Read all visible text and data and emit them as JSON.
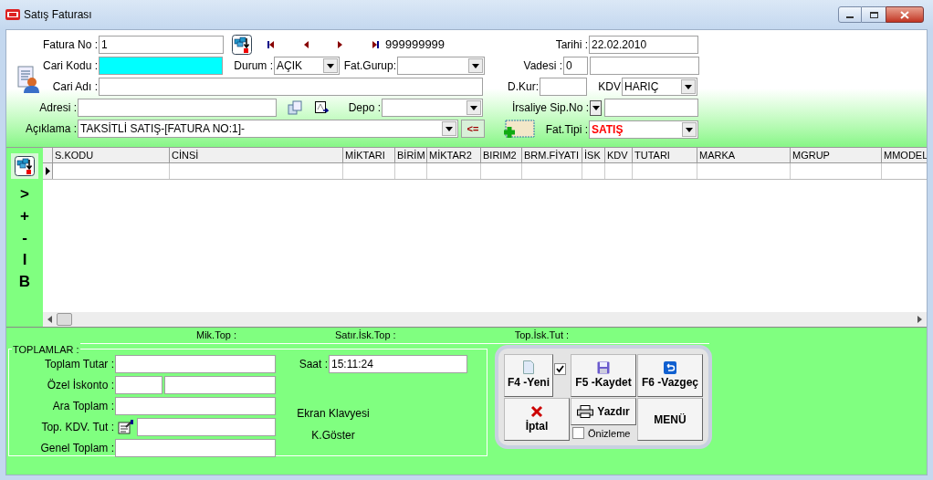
{
  "window": {
    "title": "Satış Faturası"
  },
  "header": {
    "fatura_no": {
      "label": "Fatura No :",
      "value": "1"
    },
    "record_number": "999999999",
    "cari_kodu": {
      "label": "Cari Kodu :"
    },
    "durum": {
      "label": "Durum :",
      "value": "AÇIK"
    },
    "fat_gurup": {
      "label": "Fat.Gurup:"
    },
    "cari_adi": {
      "label": "Cari Adı :"
    },
    "adresi": {
      "label": "Adresi :"
    },
    "depo": {
      "label": "Depo :"
    },
    "aciklama": {
      "label": "Açıklama :",
      "value": "TAKSİTLİ SATIŞ-[FATURA NO:1]-"
    },
    "aciklama_button": "<=",
    "tarihi": {
      "label": "Tarihi :",
      "value": "22.02.2010"
    },
    "vadesi": {
      "label": "Vadesi :",
      "value": "0"
    },
    "d_kur": {
      "label": "D.Kur:"
    },
    "kdv": {
      "label": "KDV",
      "value": "HARIÇ"
    },
    "irsaliye": {
      "label": "İrsaliye Sip.No :"
    },
    "fat_tipi": {
      "label": "Fat.Tipi :",
      "value": "SATIŞ"
    }
  },
  "side_buttons": [
    ">",
    "+",
    "-",
    "I",
    "B"
  ],
  "table": {
    "columns": [
      "S.KODU",
      "CİNSİ",
      "MİKTARI",
      "BİRİM",
      "MİKTAR2",
      "BIRIM2",
      "BRM.FİYATI",
      "İSK",
      "KDV",
      "TUTARI",
      "MARKA",
      "MGRUP",
      "MMODEL"
    ]
  },
  "summary": [
    "Mik.Top :",
    "Satır.İsk.Top :",
    "Top.İsk.Tut :"
  ],
  "totals": {
    "title": "TOPLAMLAR :",
    "toplam_tutar": "Toplam Tutar :",
    "ozel_iskonto": "Özel İskonto :",
    "ara_toplam": "Ara Toplam :",
    "top_kdv_tut": "Top. KDV. Tut :",
    "genel_toplam": "Genel Toplam :",
    "saat": {
      "label": "Saat :",
      "value": "15:11:24"
    },
    "ekran_klavyesi": "Ekran Klavyesi",
    "k_goster": "K.Göster"
  },
  "actions": {
    "yeni": {
      "label": "F4 -Yeni",
      "checked": true
    },
    "kaydet": "F5 -Kaydet",
    "vazgec": "F6 -Vazgeç",
    "iptal": "İptal",
    "yazdir": "Yazdır",
    "onizleme": {
      "label": "Önizleme",
      "checked": false
    },
    "menu": "MENÜ"
  }
}
